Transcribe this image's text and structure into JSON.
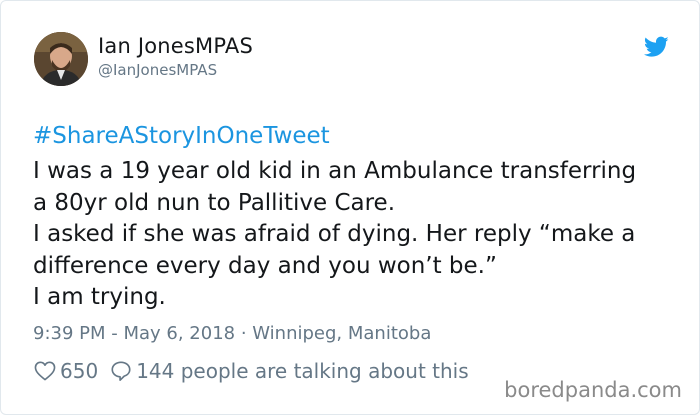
{
  "tweet": {
    "author_name": "Ian JonesMPAS",
    "author_handle": "@IanJonesMPAS",
    "hashtag": "#ShareAStoryInOneTweet",
    "lines": [
      "I was a 19 year old kid in an Ambulance transferring",
      "a 80yr old nun to Pallitive Care.",
      "I asked if she was afraid of dying. Her reply “make a",
      "difference every day and you won’t be.”",
      "I am trying."
    ],
    "meta": "9:39 PM - May 6, 2018 · Winnipeg, Manitoba",
    "likes": "650",
    "talking": "144 people are talking about this"
  },
  "icons": {
    "platform": "twitter-bird-icon",
    "like": "heart-icon",
    "reply": "speech-bubble-icon"
  },
  "colors": {
    "twitter_blue": "#1da1f2",
    "hashtag": "#1b95e0",
    "secondary_text": "#657786"
  },
  "watermark": "boredpanda.com"
}
